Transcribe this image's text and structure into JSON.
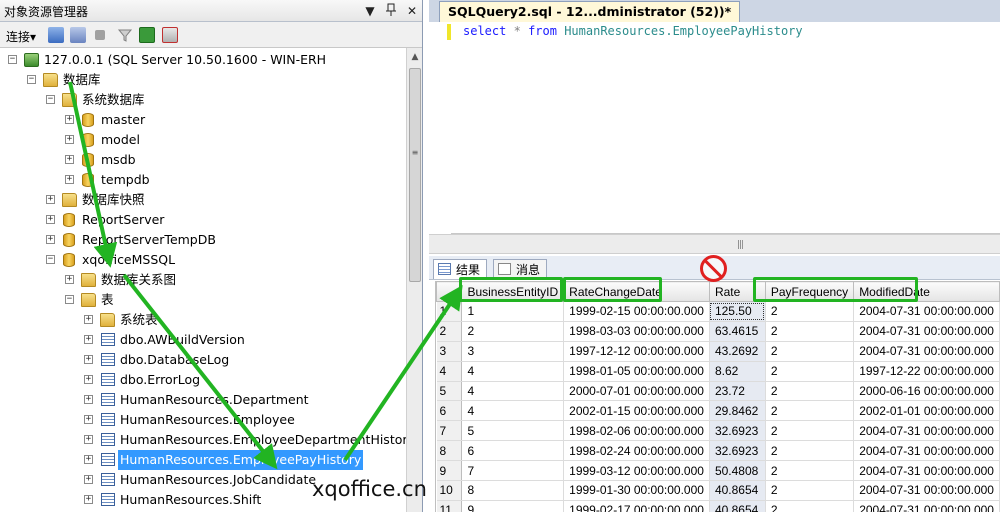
{
  "object_explorer": {
    "title": "对象资源管理器",
    "title_buttons": [
      "▼",
      "ꟷ",
      "✕"
    ],
    "toolbar": {
      "connect_label": "连接",
      "connect_dropdown": "▾"
    },
    "tree": {
      "server": "127.0.0.1 (SQL Server 10.50.1600 - WIN-ERH",
      "databases": "数据库",
      "system_databases": "系统数据库",
      "sys_dbs": [
        "master",
        "model",
        "msdb",
        "tempdb"
      ],
      "snapshots": "数据库快照",
      "report_server": "ReportServer",
      "report_server_temp": "ReportServerTempDB",
      "xqoffice": "xqofficeMSSQL",
      "diagrams": "数据库关系图",
      "tables": "表",
      "system_tables": "系统表",
      "table_items": [
        "dbo.AWBuildVersion",
        "dbo.DatabaseLog",
        "dbo.ErrorLog",
        "HumanResources.Department",
        "HumanResources.Employee",
        "HumanResources.EmployeeDepartmentHistory",
        "HumanResources.EmployeePayHistory",
        "HumanResources.JobCandidate",
        "HumanResources.Shift"
      ]
    }
  },
  "query_window": {
    "tab_title": "SQLQuery2.sql - 12...dministrator (52))*",
    "sql": {
      "kw1": "select",
      "star": "*",
      "kw2": "from",
      "object": "HumanResources.EmployeePayHistory"
    },
    "result_tabs": {
      "results": "结果",
      "messages": "消息"
    },
    "grid": {
      "columns": [
        "BusinessEntityID",
        "RateChangeDate",
        "Rate",
        "PayFrequency",
        "ModifiedDate"
      ],
      "rows": [
        [
          "1",
          "1",
          "1999-02-15 00:00:00.000",
          "125.50",
          "2",
          "2004-07-31 00:00:00.000"
        ],
        [
          "2",
          "2",
          "1998-03-03 00:00:00.000",
          "63.4615",
          "2",
          "2004-07-31 00:00:00.000"
        ],
        [
          "3",
          "3",
          "1997-12-12 00:00:00.000",
          "43.2692",
          "2",
          "2004-07-31 00:00:00.000"
        ],
        [
          "4",
          "4",
          "1998-01-05 00:00:00.000",
          "8.62",
          "2",
          "1997-12-22 00:00:00.000"
        ],
        [
          "5",
          "4",
          "2000-07-01 00:00:00.000",
          "23.72",
          "2",
          "2000-06-16 00:00:00.000"
        ],
        [
          "6",
          "4",
          "2002-01-15 00:00:00.000",
          "29.8462",
          "2",
          "2002-01-01 00:00:00.000"
        ],
        [
          "7",
          "5",
          "1998-02-06 00:00:00.000",
          "32.6923",
          "2",
          "2004-07-31 00:00:00.000"
        ],
        [
          "8",
          "6",
          "1998-02-24 00:00:00.000",
          "32.6923",
          "2",
          "2004-07-31 00:00:00.000"
        ],
        [
          "9",
          "7",
          "1999-03-12 00:00:00.000",
          "50.4808",
          "2",
          "2004-07-31 00:00:00.000"
        ],
        [
          "10",
          "8",
          "1999-01-30 00:00:00.000",
          "40.8654",
          "2",
          "2004-07-31 00:00:00.000"
        ],
        [
          "11",
          "9",
          "1999-02-17 00:00:00.000",
          "40.8654",
          "2",
          "2004-07-31 00:00:00.000"
        ]
      ]
    }
  },
  "watermark": "xqoffice.cn",
  "colors": {
    "highlight_green": "#22b422",
    "prohibit_red": "#e02020",
    "selection_blue": "#3399ff"
  }
}
